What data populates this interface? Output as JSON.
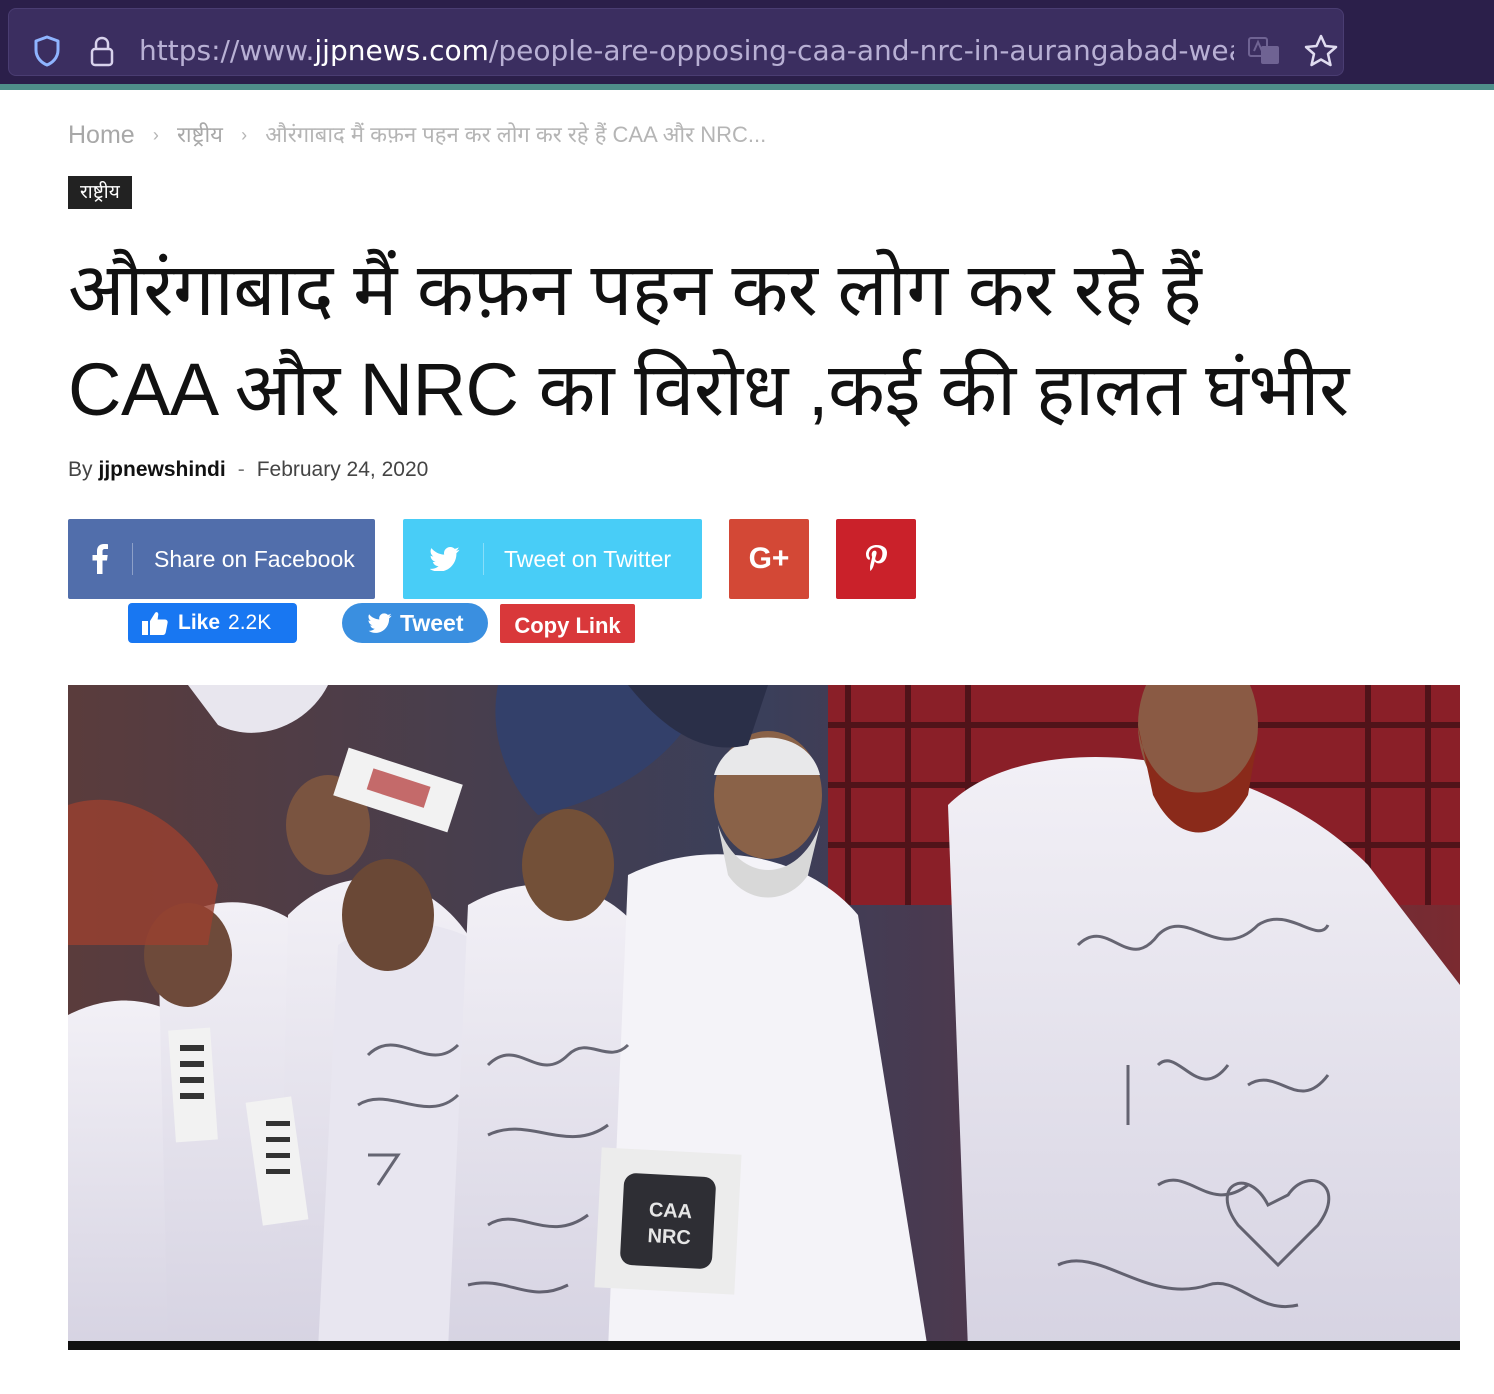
{
  "browser": {
    "url_prefix": "https://www.",
    "url_domain": "jjpnews.com",
    "url_path": "/people-are-opposing-caa-and-nrc-in-aurangabad-wearing",
    "icons": [
      "shield-icon",
      "lock-icon",
      "translate-icon",
      "star-icon"
    ]
  },
  "breadcrumb": {
    "home": "Home",
    "category": "राष्ट्रीय",
    "current": "औरंगाबाद मैं कफ़न पहन कर लोग कर रहे हैं CAA और NRC...",
    "separator": "›"
  },
  "article": {
    "category_tag": "राष्ट्रीय",
    "title_line1": "औरंगाबाद मैं कफ़न पहन कर लोग कर रहे हैं",
    "title_line2": "CAA और NRC का विरोध ,कई की हालत घंभीर",
    "by_label": "By",
    "author": "jjpnewshindi",
    "date_separator": "-",
    "date": "February 24, 2020"
  },
  "share": {
    "facebook_label": "Share on Facebook",
    "twitter_label": "Tweet on Twitter",
    "gplus_label": "G+",
    "like_label": "Like",
    "like_count": "2.2K",
    "tweet_label": "Tweet",
    "copy_label": "Copy Link"
  },
  "photo": {
    "sign_text_1": "CAA",
    "sign_text_2": "NRC"
  },
  "colors": {
    "facebook": "#516eab",
    "twitter": "#29c5f6",
    "gplus": "#d34836",
    "pinterest": "#ca212a",
    "like": "#1877f2",
    "copy": "#d9383a",
    "browser_bg": "#2b1f4a",
    "accent_line": "#4f8f8a"
  }
}
